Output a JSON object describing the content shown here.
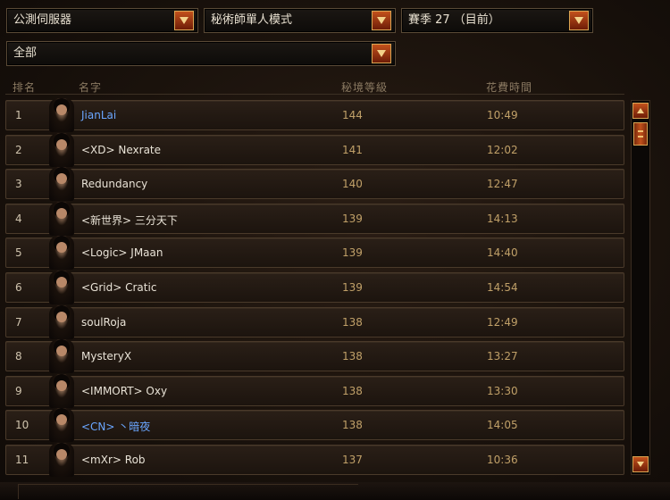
{
  "filters": {
    "server": "公測伺服器",
    "mode": "秘術師單人模式",
    "season": "賽季 27 （目前）",
    "category": "全部"
  },
  "columns": {
    "rank": "排名",
    "name": "名字",
    "level": "秘境等級",
    "time": "花費時間"
  },
  "rows": [
    {
      "rank": "1",
      "name": "JianLai",
      "level": "144",
      "time": "10:49",
      "highlight": true
    },
    {
      "rank": "2",
      "name": "<XD> Nexrate",
      "level": "141",
      "time": "12:02",
      "highlight": false
    },
    {
      "rank": "3",
      "name": "Redundancy",
      "level": "140",
      "time": "12:47",
      "highlight": false
    },
    {
      "rank": "4",
      "name": "<新世界> 三分天下",
      "level": "139",
      "time": "14:13",
      "highlight": false
    },
    {
      "rank": "5",
      "name": "<Logic> JMaan",
      "level": "139",
      "time": "14:40",
      "highlight": false
    },
    {
      "rank": "6",
      "name": "<Grid> Cratic",
      "level": "139",
      "time": "14:54",
      "highlight": false
    },
    {
      "rank": "7",
      "name": "soulRoja",
      "level": "138",
      "time": "12:49",
      "highlight": false
    },
    {
      "rank": "8",
      "name": "MysteryX",
      "level": "138",
      "time": "13:27",
      "highlight": false
    },
    {
      "rank": "9",
      "name": "<IMMORT> Oxy",
      "level": "138",
      "time": "13:30",
      "highlight": false
    },
    {
      "rank": "10",
      "name": "<CN> 丶暗夜",
      "level": "138",
      "time": "14:05",
      "highlight": true
    },
    {
      "rank": "11",
      "name": "<mXr> Rob",
      "level": "137",
      "time": "10:36",
      "highlight": false
    }
  ],
  "icons": {
    "dropdown": "chevron-down-icon",
    "scroll_up": "arrow-up-icon",
    "scroll_down": "arrow-down-icon",
    "avatar": "wizard-portrait-icon"
  },
  "colors": {
    "accent": "#c2511c",
    "highlight_name": "#6aa6ff",
    "value_gold": "#c0a068"
  }
}
